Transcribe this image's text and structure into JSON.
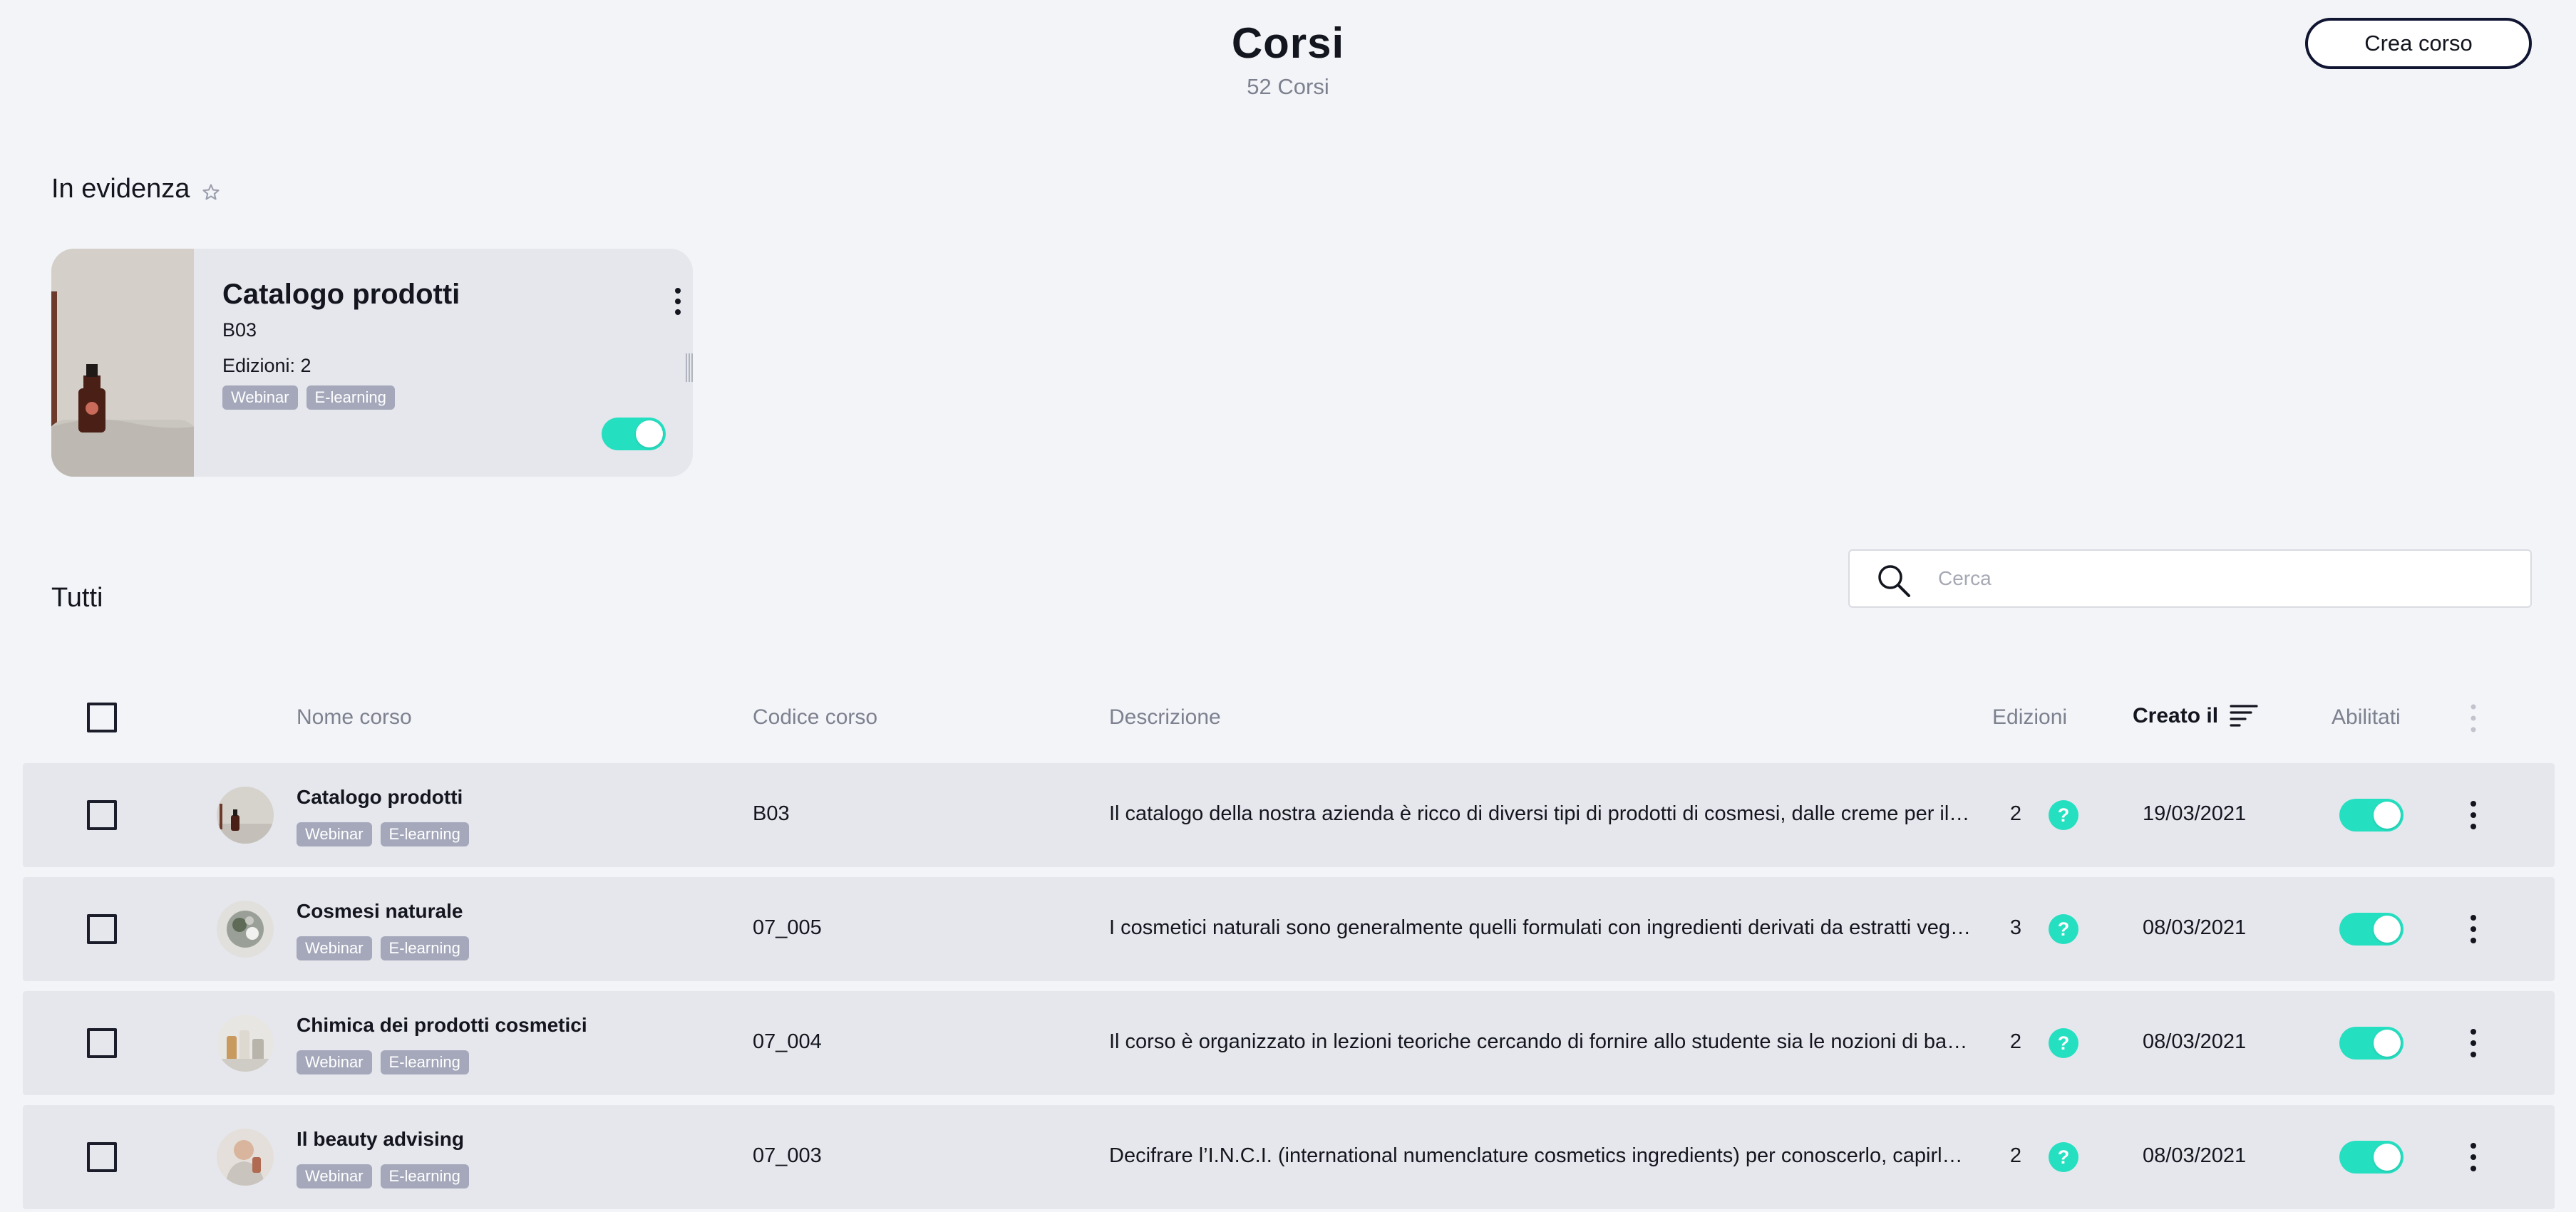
{
  "header": {
    "title": "Corsi",
    "subtitle": "52 Corsi",
    "create_label": "Crea corso"
  },
  "featured": {
    "section_title": "In evidenza",
    "star_icon": "star-outline-icon",
    "card": {
      "title": "Catalogo prodotti",
      "code": "B03",
      "editions": "Edizioni: 2",
      "tags": [
        "Webinar",
        "E-learning"
      ],
      "enabled": true
    }
  },
  "all": {
    "section_title": "Tutti",
    "search": {
      "placeholder": "Cerca",
      "value": ""
    }
  },
  "table": {
    "columns": {
      "name": "Nome corso",
      "code": "Codice corso",
      "description": "Descrizione",
      "editions": "Edizioni",
      "created": "Creato il",
      "enabled": "Abilitati"
    },
    "rows": [
      {
        "name": "Catalogo prodotti",
        "tags": [
          "Webinar",
          "E-learning"
        ],
        "code": "B03",
        "description": "Il catalogo della nostra azienda è ricco di diversi tipi di prodotti di cosmesi, dalle creme per il vis...",
        "editions": "2",
        "help": "?",
        "created": "19/03/2021",
        "enabled": true
      },
      {
        "name": "Cosmesi naturale",
        "tags": [
          "Webinar",
          "E-learning"
        ],
        "code": "07_005",
        "description": "I cosmetici naturali sono generalmente quelli formulati con ingredienti derivati da estratti veget...",
        "editions": "3",
        "help": "?",
        "created": "08/03/2021",
        "enabled": true
      },
      {
        "name": "Chimica dei prodotti cosmetici",
        "tags": [
          "Webinar",
          "E-learning"
        ],
        "code": "07_004",
        "description": "Il corso è organizzato in lezioni teoriche cercando di fornire allo studente sia le nozioni di base c...",
        "editions": "2",
        "help": "?",
        "created": "08/03/2021",
        "enabled": true
      },
      {
        "name": "Il beauty advising",
        "tags": [
          "Webinar",
          "E-learning"
        ],
        "code": "07_003",
        "description": "Decifrare l’I.N.C.I. (international numenclature cosmetics ingredients) per conoscerlo, capirlo, sfr...",
        "editions": "2",
        "help": "?",
        "created": "08/03/2021",
        "enabled": true
      }
    ]
  },
  "colors": {
    "accent": "#25dfc1",
    "background": "#f3f4f8",
    "row_background": "#e6e7ec",
    "tag_background": "#a4a8ba",
    "primary_border": "#101532"
  }
}
